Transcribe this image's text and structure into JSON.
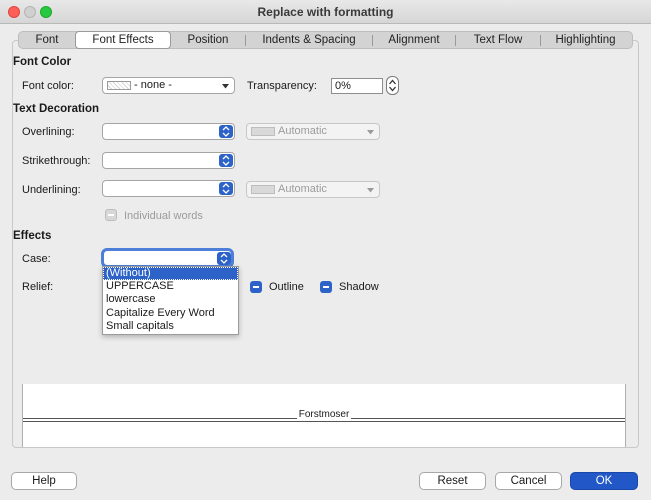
{
  "window": {
    "title": "Replace with formatting"
  },
  "tabs": [
    {
      "label": "Font"
    },
    {
      "label": "Font Effects",
      "active": true
    },
    {
      "label": "Position"
    },
    {
      "label": "Indents & Spacing"
    },
    {
      "label": "Alignment"
    },
    {
      "label": "Text Flow"
    },
    {
      "label": "Highlighting"
    }
  ],
  "font_color": {
    "section_title": "Font Color",
    "label": "Font color:",
    "value": "- none -",
    "transparency_label": "Transparency:",
    "transparency_value": "0%"
  },
  "text_decoration": {
    "section_title": "Text Decoration",
    "overlining_label": "Overlining:",
    "overlining_color": "Automatic",
    "strikethrough_label": "Strikethrough:",
    "underlining_label": "Underlining:",
    "underlining_color": "Automatic",
    "individual_words_label": "Individual words"
  },
  "effects": {
    "section_title": "Effects",
    "case_label": "Case:",
    "relief_label": "Relief:",
    "outline_label": "Outline",
    "shadow_label": "Shadow",
    "case_options": [
      "(Without)",
      "UPPERCASE",
      "lowercase",
      "Capitalize Every Word",
      "Small capitals"
    ],
    "case_selected_index": 0
  },
  "preview": {
    "text": "Forstmoser"
  },
  "buttons": {
    "help": "Help",
    "reset": "Reset",
    "cancel": "Cancel",
    "ok": "OK"
  },
  "colors": {
    "accent": "#2d63c8",
    "ok_button": "#2257c7"
  }
}
